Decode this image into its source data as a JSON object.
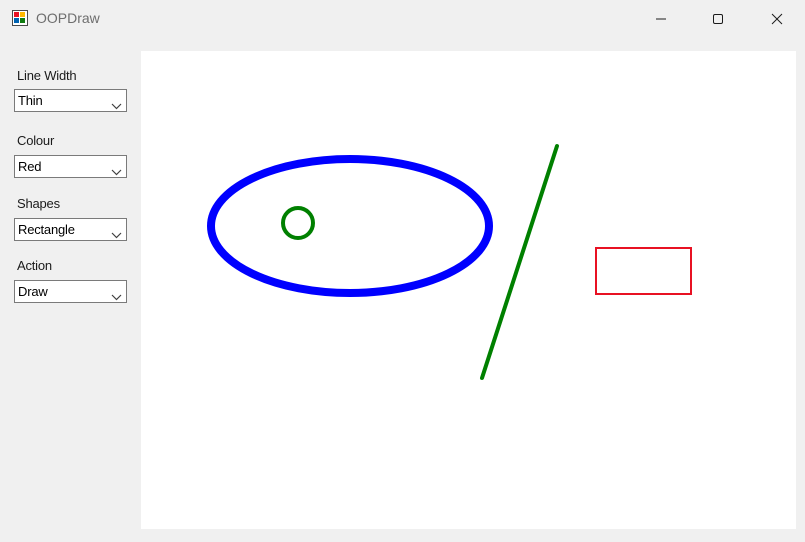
{
  "window": {
    "title": "OOPDraw",
    "icon": "app-paint-icon"
  },
  "controls": {
    "line_width": {
      "label": "Line Width",
      "value": "Thin"
    },
    "colour": {
      "label": "Colour",
      "value": "Red"
    },
    "shapes": {
      "label": "Shapes",
      "value": "Rectangle"
    },
    "action": {
      "label": "Action",
      "value": "Draw"
    }
  },
  "canvas": {
    "shapes": [
      {
        "kind": "ellipse",
        "color": "#0000ff",
        "weight": "thick"
      },
      {
        "kind": "circle",
        "color": "#008000",
        "weight": "medium"
      },
      {
        "kind": "line",
        "color": "#008000",
        "weight": "medium"
      },
      {
        "kind": "rectangle",
        "color": "#e81123",
        "weight": "thin"
      }
    ]
  },
  "colors": {
    "blue": "#0000ff",
    "green": "#008000",
    "red": "#e81123",
    "canvas_bg": "#ffffff",
    "window_bg": "#f0f0f0"
  }
}
